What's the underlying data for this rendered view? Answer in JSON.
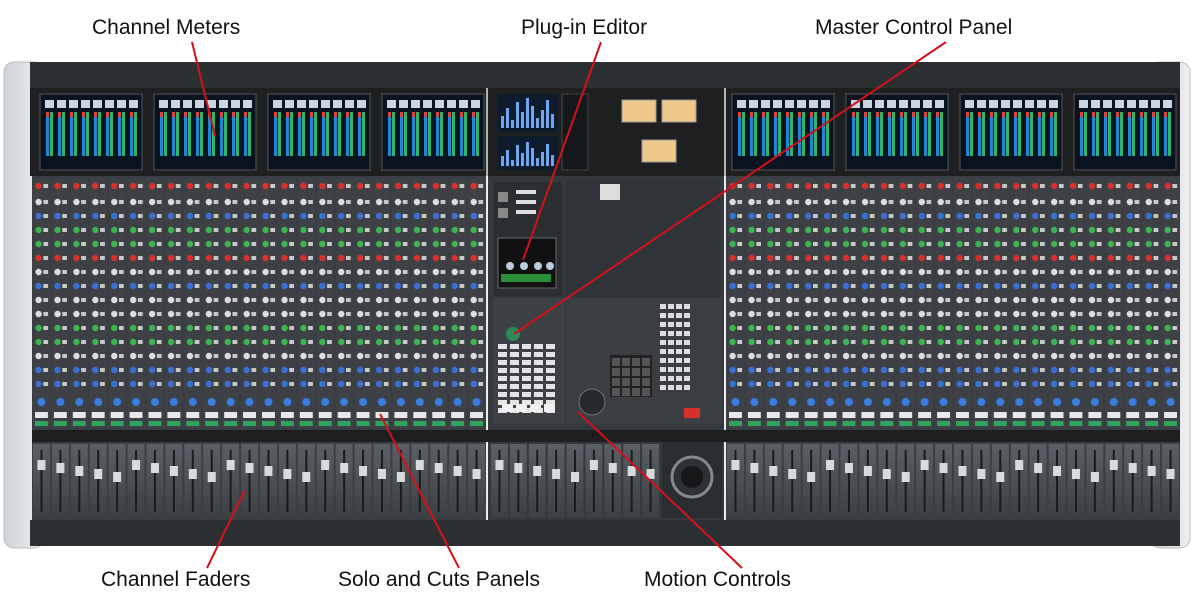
{
  "callouts": {
    "channel_meters": "Channel Meters",
    "plugin_editor": "Plug-in Editor",
    "master_control_panel": "Master Control Panel",
    "channel_faders": "Channel Faders",
    "solo_and_cuts_panels": "Solo and Cuts Panels",
    "motion_controls": "Motion Controls"
  },
  "colors": {
    "leader_line": "#d4101a",
    "console_frame": "#2f3235",
    "channel_strip": "#3d4146",
    "green_knob": "#3fb34f",
    "red_knob": "#d8312c",
    "blue_knob": "#3a6fd8",
    "vu_meter": "#f0c98a"
  },
  "icons": {
    "trackball": "trackball-icon",
    "jog_wheel": "jog-wheel-icon"
  }
}
